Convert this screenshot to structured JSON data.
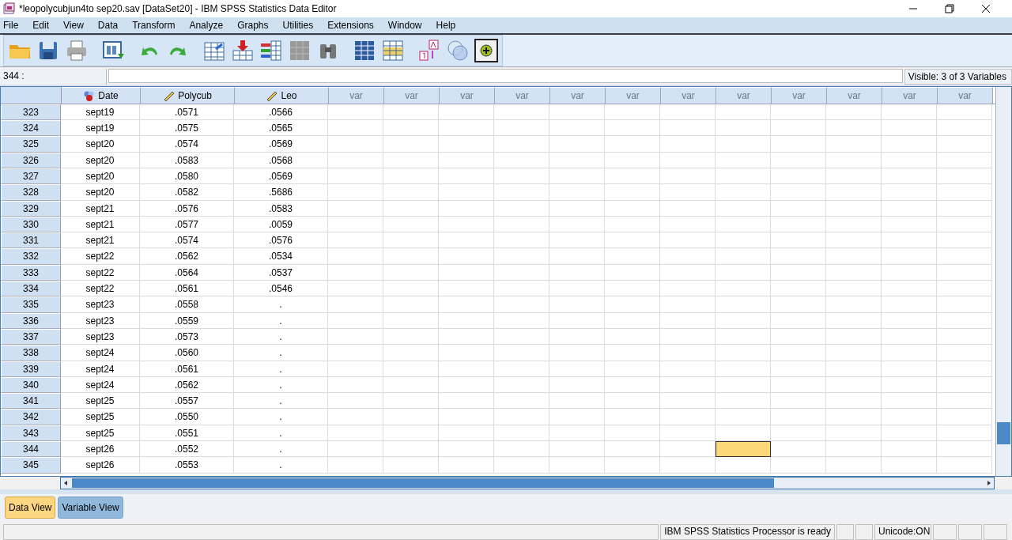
{
  "window": {
    "title": "*leopolycubjun4to sep20.sav [DataSet20] - IBM SPSS Statistics Data Editor"
  },
  "menu": [
    "File",
    "Edit",
    "View",
    "Data",
    "Transform",
    "Analyze",
    "Graphs",
    "Utilities",
    "Extensions",
    "Window",
    "Help"
  ],
  "cell_editor": {
    "cell_reference": "344 :"
  },
  "visible_variables": "Visible: 3 of 3 Variables",
  "columns": [
    {
      "label": "Date",
      "kind": "nominal"
    },
    {
      "label": "Polycub",
      "kind": "scale"
    },
    {
      "label": "Leo",
      "kind": "scale"
    },
    {
      "label": "var",
      "kind": "empty"
    },
    {
      "label": "var",
      "kind": "empty"
    },
    {
      "label": "var",
      "kind": "empty"
    },
    {
      "label": "var",
      "kind": "empty"
    },
    {
      "label": "var",
      "kind": "empty"
    },
    {
      "label": "var",
      "kind": "empty"
    },
    {
      "label": "var",
      "kind": "empty"
    },
    {
      "label": "var",
      "kind": "empty"
    },
    {
      "label": "var",
      "kind": "empty"
    },
    {
      "label": "var",
      "kind": "empty"
    },
    {
      "label": "var",
      "kind": "empty"
    },
    {
      "label": "var",
      "kind": "empty"
    }
  ],
  "rows": [
    {
      "case": "323",
      "values": [
        "sept19",
        ".0571",
        ".0566"
      ],
      "var_cells": [
        {
          "selected": false
        },
        {
          "selected": false
        },
        {
          "selected": false
        },
        {
          "selected": false
        },
        {
          "selected": false
        },
        {
          "selected": false
        },
        {
          "selected": false
        },
        {
          "selected": false
        },
        {
          "selected": false
        },
        {
          "selected": false
        },
        {
          "selected": false
        },
        {
          "selected": false
        }
      ]
    },
    {
      "case": "324",
      "values": [
        "sept19",
        ".0575",
        ".0565"
      ],
      "var_cells": [
        {
          "selected": false
        },
        {
          "selected": false
        },
        {
          "selected": false
        },
        {
          "selected": false
        },
        {
          "selected": false
        },
        {
          "selected": false
        },
        {
          "selected": false
        },
        {
          "selected": false
        },
        {
          "selected": false
        },
        {
          "selected": false
        },
        {
          "selected": false
        },
        {
          "selected": false
        }
      ]
    },
    {
      "case": "325",
      "values": [
        "sept20",
        ".0574",
        ".0569"
      ],
      "var_cells": [
        {
          "selected": false
        },
        {
          "selected": false
        },
        {
          "selected": false
        },
        {
          "selected": false
        },
        {
          "selected": false
        },
        {
          "selected": false
        },
        {
          "selected": false
        },
        {
          "selected": false
        },
        {
          "selected": false
        },
        {
          "selected": false
        },
        {
          "selected": false
        },
        {
          "selected": false
        }
      ]
    },
    {
      "case": "326",
      "values": [
        "sept20",
        ".0583",
        ".0568"
      ],
      "var_cells": [
        {
          "selected": false
        },
        {
          "selected": false
        },
        {
          "selected": false
        },
        {
          "selected": false
        },
        {
          "selected": false
        },
        {
          "selected": false
        },
        {
          "selected": false
        },
        {
          "selected": false
        },
        {
          "selected": false
        },
        {
          "selected": false
        },
        {
          "selected": false
        },
        {
          "selected": false
        }
      ]
    },
    {
      "case": "327",
      "values": [
        "sept20",
        ".0580",
        ".0569"
      ],
      "var_cells": [
        {
          "selected": false
        },
        {
          "selected": false
        },
        {
          "selected": false
        },
        {
          "selected": false
        },
        {
          "selected": false
        },
        {
          "selected": false
        },
        {
          "selected": false
        },
        {
          "selected": false
        },
        {
          "selected": false
        },
        {
          "selected": false
        },
        {
          "selected": false
        },
        {
          "selected": false
        }
      ]
    },
    {
      "case": "328",
      "values": [
        "sept20",
        ".0582",
        ".5686"
      ],
      "var_cells": [
        {
          "selected": false
        },
        {
          "selected": false
        },
        {
          "selected": false
        },
        {
          "selected": false
        },
        {
          "selected": false
        },
        {
          "selected": false
        },
        {
          "selected": false
        },
        {
          "selected": false
        },
        {
          "selected": false
        },
        {
          "selected": false
        },
        {
          "selected": false
        },
        {
          "selected": false
        }
      ]
    },
    {
      "case": "329",
      "values": [
        "sept21",
        ".0576",
        ".0583"
      ],
      "var_cells": [
        {
          "selected": false
        },
        {
          "selected": false
        },
        {
          "selected": false
        },
        {
          "selected": false
        },
        {
          "selected": false
        },
        {
          "selected": false
        },
        {
          "selected": false
        },
        {
          "selected": false
        },
        {
          "selected": false
        },
        {
          "selected": false
        },
        {
          "selected": false
        },
        {
          "selected": false
        }
      ]
    },
    {
      "case": "330",
      "values": [
        "sept21",
        ".0577",
        ".0059"
      ],
      "var_cells": [
        {
          "selected": false
        },
        {
          "selected": false
        },
        {
          "selected": false
        },
        {
          "selected": false
        },
        {
          "selected": false
        },
        {
          "selected": false
        },
        {
          "selected": false
        },
        {
          "selected": false
        },
        {
          "selected": false
        },
        {
          "selected": false
        },
        {
          "selected": false
        },
        {
          "selected": false
        }
      ]
    },
    {
      "case": "331",
      "values": [
        "sept21",
        ".0574",
        ".0576"
      ],
      "var_cells": [
        {
          "selected": false
        },
        {
          "selected": false
        },
        {
          "selected": false
        },
        {
          "selected": false
        },
        {
          "selected": false
        },
        {
          "selected": false
        },
        {
          "selected": false
        },
        {
          "selected": false
        },
        {
          "selected": false
        },
        {
          "selected": false
        },
        {
          "selected": false
        },
        {
          "selected": false
        }
      ]
    },
    {
      "case": "332",
      "values": [
        "sept22",
        ".0562",
        ".0534"
      ],
      "var_cells": [
        {
          "selected": false
        },
        {
          "selected": false
        },
        {
          "selected": false
        },
        {
          "selected": false
        },
        {
          "selected": false
        },
        {
          "selected": false
        },
        {
          "selected": false
        },
        {
          "selected": false
        },
        {
          "selected": false
        },
        {
          "selected": false
        },
        {
          "selected": false
        },
        {
          "selected": false
        }
      ]
    },
    {
      "case": "333",
      "values": [
        "sept22",
        ".0564",
        ".0537"
      ],
      "var_cells": [
        {
          "selected": false
        },
        {
          "selected": false
        },
        {
          "selected": false
        },
        {
          "selected": false
        },
        {
          "selected": false
        },
        {
          "selected": false
        },
        {
          "selected": false
        },
        {
          "selected": false
        },
        {
          "selected": false
        },
        {
          "selected": false
        },
        {
          "selected": false
        },
        {
          "selected": false
        }
      ]
    },
    {
      "case": "334",
      "values": [
        "sept22",
        ".0561",
        ".0546"
      ],
      "var_cells": [
        {
          "selected": false
        },
        {
          "selected": false
        },
        {
          "selected": false
        },
        {
          "selected": false
        },
        {
          "selected": false
        },
        {
          "selected": false
        },
        {
          "selected": false
        },
        {
          "selected": false
        },
        {
          "selected": false
        },
        {
          "selected": false
        },
        {
          "selected": false
        },
        {
          "selected": false
        }
      ]
    },
    {
      "case": "335",
      "values": [
        "sept23",
        ".0558",
        "."
      ],
      "var_cells": [
        {
          "selected": false
        },
        {
          "selected": false
        },
        {
          "selected": false
        },
        {
          "selected": false
        },
        {
          "selected": false
        },
        {
          "selected": false
        },
        {
          "selected": false
        },
        {
          "selected": false
        },
        {
          "selected": false
        },
        {
          "selected": false
        },
        {
          "selected": false
        },
        {
          "selected": false
        }
      ]
    },
    {
      "case": "336",
      "values": [
        "sept23",
        ".0559",
        "."
      ],
      "var_cells": [
        {
          "selected": false
        },
        {
          "selected": false
        },
        {
          "selected": false
        },
        {
          "selected": false
        },
        {
          "selected": false
        },
        {
          "selected": false
        },
        {
          "selected": false
        },
        {
          "selected": false
        },
        {
          "selected": false
        },
        {
          "selected": false
        },
        {
          "selected": false
        },
        {
          "selected": false
        }
      ]
    },
    {
      "case": "337",
      "values": [
        "sept23",
        ".0573",
        "."
      ],
      "var_cells": [
        {
          "selected": false
        },
        {
          "selected": false
        },
        {
          "selected": false
        },
        {
          "selected": false
        },
        {
          "selected": false
        },
        {
          "selected": false
        },
        {
          "selected": false
        },
        {
          "selected": false
        },
        {
          "selected": false
        },
        {
          "selected": false
        },
        {
          "selected": false
        },
        {
          "selected": false
        }
      ]
    },
    {
      "case": "338",
      "values": [
        "sept24",
        ".0560",
        "."
      ],
      "var_cells": [
        {
          "selected": false
        },
        {
          "selected": false
        },
        {
          "selected": false
        },
        {
          "selected": false
        },
        {
          "selected": false
        },
        {
          "selected": false
        },
        {
          "selected": false
        },
        {
          "selected": false
        },
        {
          "selected": false
        },
        {
          "selected": false
        },
        {
          "selected": false
        },
        {
          "selected": false
        }
      ]
    },
    {
      "case": "339",
      "values": [
        "sept24",
        ".0561",
        "."
      ],
      "var_cells": [
        {
          "selected": false
        },
        {
          "selected": false
        },
        {
          "selected": false
        },
        {
          "selected": false
        },
        {
          "selected": false
        },
        {
          "selected": false
        },
        {
          "selected": false
        },
        {
          "selected": false
        },
        {
          "selected": false
        },
        {
          "selected": false
        },
        {
          "selected": false
        },
        {
          "selected": false
        }
      ]
    },
    {
      "case": "340",
      "values": [
        "sept24",
        ".0562",
        "."
      ],
      "var_cells": [
        {
          "selected": false
        },
        {
          "selected": false
        },
        {
          "selected": false
        },
        {
          "selected": false
        },
        {
          "selected": false
        },
        {
          "selected": false
        },
        {
          "selected": false
        },
        {
          "selected": false
        },
        {
          "selected": false
        },
        {
          "selected": false
        },
        {
          "selected": false
        },
        {
          "selected": false
        }
      ]
    },
    {
      "case": "341",
      "values": [
        "sept25",
        ".0557",
        "."
      ],
      "var_cells": [
        {
          "selected": false
        },
        {
          "selected": false
        },
        {
          "selected": false
        },
        {
          "selected": false
        },
        {
          "selected": false
        },
        {
          "selected": false
        },
        {
          "selected": false
        },
        {
          "selected": false
        },
        {
          "selected": false
        },
        {
          "selected": false
        },
        {
          "selected": false
        },
        {
          "selected": false
        }
      ]
    },
    {
      "case": "342",
      "values": [
        "sept25",
        ".0550",
        "."
      ],
      "var_cells": [
        {
          "selected": false
        },
        {
          "selected": false
        },
        {
          "selected": false
        },
        {
          "selected": false
        },
        {
          "selected": false
        },
        {
          "selected": false
        },
        {
          "selected": false
        },
        {
          "selected": false
        },
        {
          "selected": false
        },
        {
          "selected": false
        },
        {
          "selected": false
        },
        {
          "selected": false
        }
      ]
    },
    {
      "case": "343",
      "values": [
        "sept25",
        ".0551",
        "."
      ],
      "var_cells": [
        {
          "selected": false
        },
        {
          "selected": false
        },
        {
          "selected": false
        },
        {
          "selected": false
        },
        {
          "selected": false
        },
        {
          "selected": false
        },
        {
          "selected": false
        },
        {
          "selected": false
        },
        {
          "selected": false
        },
        {
          "selected": false
        },
        {
          "selected": false
        },
        {
          "selected": false
        }
      ]
    },
    {
      "case": "344",
      "values": [
        "sept26",
        ".0552",
        "."
      ],
      "var_cells": [
        {
          "selected": false
        },
        {
          "selected": false
        },
        {
          "selected": false
        },
        {
          "selected": false
        },
        {
          "selected": false
        },
        {
          "selected": false
        },
        {
          "selected": false
        },
        {
          "selected": true
        },
        {
          "selected": false
        },
        {
          "selected": false
        },
        {
          "selected": false
        },
        {
          "selected": false
        }
      ]
    },
    {
      "case": "345",
      "values": [
        "sept26",
        ".0553",
        "."
      ],
      "var_cells": [
        {
          "selected": false
        },
        {
          "selected": false
        },
        {
          "selected": false
        },
        {
          "selected": false
        },
        {
          "selected": false
        },
        {
          "selected": false
        },
        {
          "selected": false
        },
        {
          "selected": false
        },
        {
          "selected": false
        },
        {
          "selected": false
        },
        {
          "selected": false
        },
        {
          "selected": false
        }
      ]
    }
  ],
  "view_tabs": [
    {
      "label": "Data View",
      "selected": true
    },
    {
      "label": "Variable View",
      "selected": false
    }
  ],
  "status_bar": {
    "processor": "IBM SPSS Statistics Processor is ready",
    "unicode": "Unicode:ON"
  }
}
